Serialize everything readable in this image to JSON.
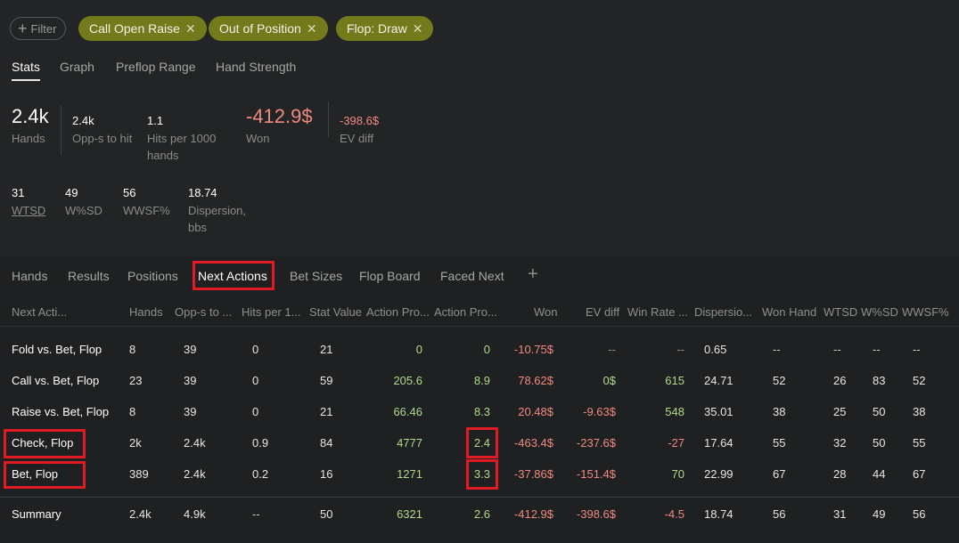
{
  "filters": {
    "add_label": "Filter",
    "chips": [
      "Call Open Raise",
      "Out of Position",
      "Flop: Draw"
    ]
  },
  "top_tabs": [
    "Stats",
    "Graph",
    "Preflop Range",
    "Hand Strength"
  ],
  "stats": {
    "hands": {
      "value": "2.4k",
      "label": "Hands"
    },
    "opps": {
      "value": "2.4k",
      "label": "Opp-s to hit"
    },
    "hits": {
      "value": "1.1",
      "label1": "Hits per 1000",
      "label2": "hands"
    },
    "won": {
      "value": "-412.9$",
      "label": "Won"
    },
    "ev": {
      "value": "-398.6$",
      "label": "EV diff"
    },
    "wtsd": {
      "value": "31",
      "label": "WTSD"
    },
    "wsd": {
      "value": "49",
      "label": "W%SD"
    },
    "wwsf": {
      "value": "56",
      "label": "WWSF%"
    },
    "disp": {
      "value": "18.74",
      "label1": "Dispersion,",
      "label2": "bbs"
    }
  },
  "bottom_tabs": [
    "Hands",
    "Results",
    "Positions",
    "Next Actions",
    "Bet Sizes",
    "Flop Board",
    "Faced Next",
    "+"
  ],
  "table": {
    "headers": [
      "Next Acti...",
      "Hands",
      "Opp-s to ...",
      "Hits per 1...",
      "Stat Value",
      "Action Pro...",
      "Action Pro...",
      "Won",
      "EV diff",
      "Win Rate ...",
      "Dispersio...",
      "Won Hand",
      "WTSD",
      "W%SD",
      "WWSF%"
    ],
    "rows": [
      [
        "Fold vs. Bet, Flop",
        "8",
        "39",
        "0",
        "21",
        "0",
        "0",
        "-10.75$",
        "--",
        "--",
        "0.65",
        "--",
        "--",
        "--",
        "--"
      ],
      [
        "Call vs. Bet, Flop",
        "23",
        "39",
        "0",
        "59",
        "205.6",
        "8.9",
        "78.62$",
        "0$",
        "615",
        "24.71",
        "52",
        "26",
        "83",
        "52"
      ],
      [
        "Raise vs. Bet, Flop",
        "8",
        "39",
        "0",
        "21",
        "66.46",
        "8.3",
        "20.48$",
        "-9.63$",
        "548",
        "35.01",
        "38",
        "25",
        "50",
        "38"
      ],
      [
        "Check, Flop",
        "2k",
        "2.4k",
        "0.9",
        "84",
        "4777",
        "2.4",
        "-463.4$",
        "-237.6$",
        "-27",
        "17.64",
        "55",
        "32",
        "50",
        "55"
      ],
      [
        "Bet, Flop",
        "389",
        "2.4k",
        "0.2",
        "16",
        "1271",
        "3.3",
        "-37.86$",
        "-151.4$",
        "70",
        "22.99",
        "67",
        "28",
        "44",
        "67"
      ]
    ],
    "summary": [
      "Summary",
      "2.4k",
      "4.9k",
      "--",
      "50",
      "6321",
      "2.6",
      "-412.9$",
      "-398.6$",
      "-4.5",
      "18.74",
      "56",
      "31",
      "49",
      "56"
    ]
  },
  "colors": {
    "chip": "#727a1c",
    "positive": "#b2d98a",
    "negative": "#ef8a80",
    "highlight": "#e01b24"
  }
}
